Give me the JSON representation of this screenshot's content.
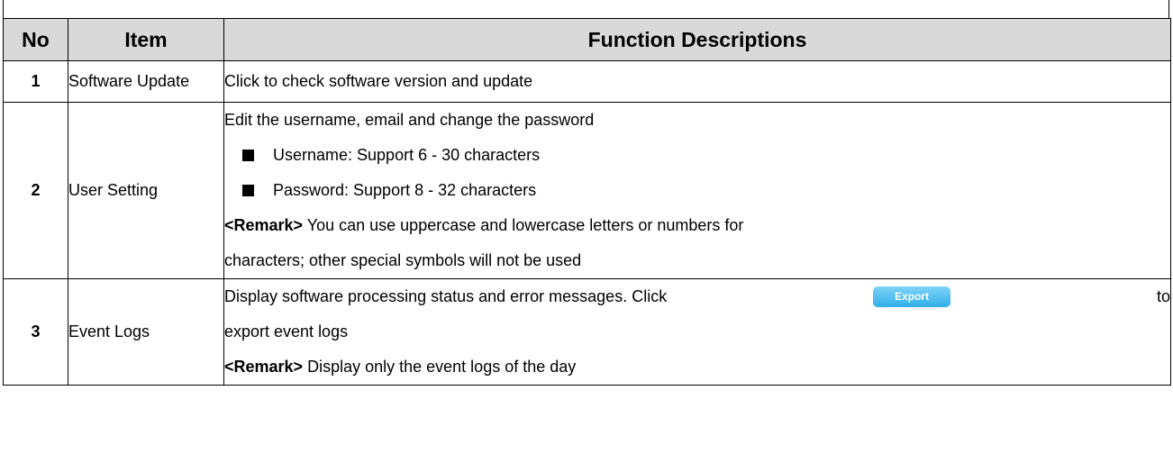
{
  "table": {
    "headers": {
      "no": "No",
      "item": "Item",
      "desc": "Function Descriptions"
    },
    "rows": [
      {
        "no": "1",
        "item": "Software Update",
        "desc": "Click to check software version and update"
      },
      {
        "no": "2",
        "item": "User Setting",
        "desc": "Edit the username, email and change the password",
        "bullets": [
          "Username: Support 6 - 30 characters",
          "Password: Support 8 - 32 characters"
        ],
        "remark_tag": "<Remark>",
        "remark_line1": " You can use uppercase and lowercase letters or numbers for",
        "remark_line2": "characters; other special symbols will not be used"
      },
      {
        "no": "3",
        "item": "Event Logs",
        "desc_before": "Display software processing status and error messages. Click",
        "button_label": "Export",
        "desc_after": "to",
        "desc_line2": "export event logs",
        "remark_tag": "<Remark>",
        "remark_text": " Display only the event logs of the day",
        "button_color": "#2fb0ea"
      }
    ]
  }
}
